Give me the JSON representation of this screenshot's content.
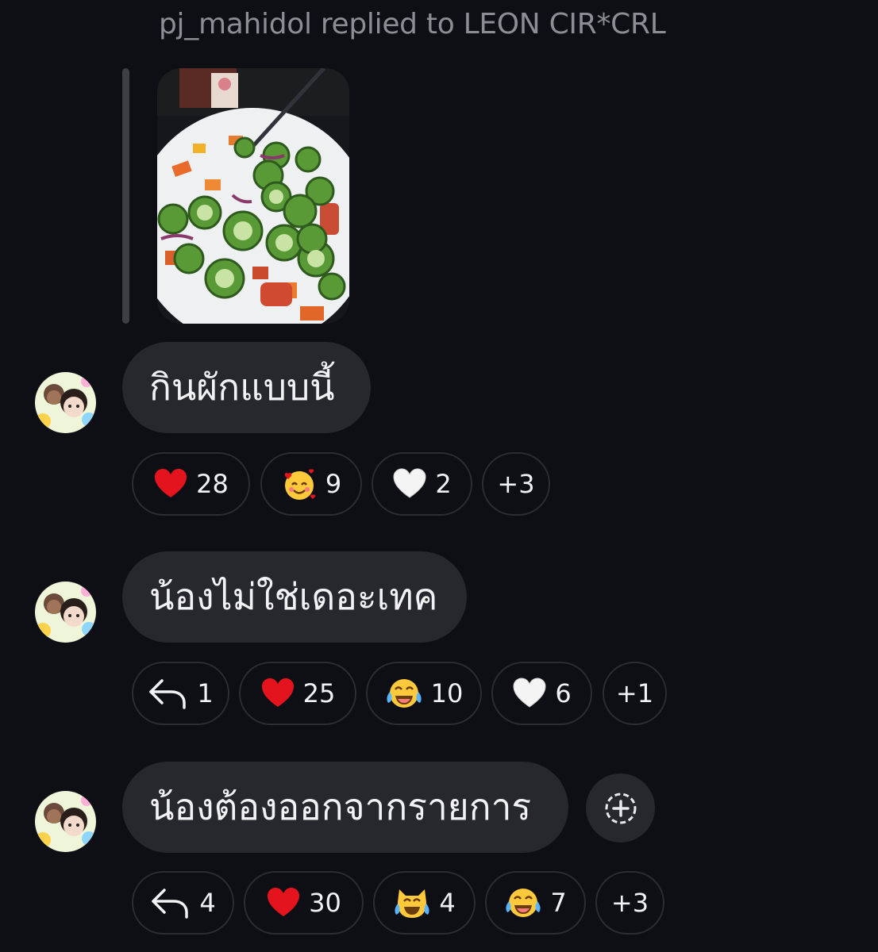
{
  "header": {
    "text": "pj_mahidol replied to LEON CIR*CRL"
  },
  "messages": [
    {
      "text": "กินผักแบบนี้",
      "reactions": [
        {
          "icon": "red-heart",
          "count": "28"
        },
        {
          "icon": "smiling-face-with-hearts",
          "count": "9"
        },
        {
          "icon": "white-heart",
          "count": "2"
        },
        {
          "label": "+3"
        }
      ]
    },
    {
      "text": "น้องไม่ใช่เดอะเทค",
      "reactions": [
        {
          "icon": "reply-arrow",
          "count": "1"
        },
        {
          "icon": "red-heart",
          "count": "25"
        },
        {
          "icon": "face-with-tears-of-joy",
          "count": "10"
        },
        {
          "icon": "white-heart",
          "count": "6"
        },
        {
          "label": "+1"
        }
      ]
    },
    {
      "text": "น้องต้องออกจากรายการ",
      "reactions": [
        {
          "icon": "reply-arrow",
          "count": "4"
        },
        {
          "icon": "red-heart",
          "count": "30"
        },
        {
          "icon": "cat-with-tears-of-joy",
          "count": "4"
        },
        {
          "icon": "face-with-tears-of-joy",
          "count": "7"
        },
        {
          "label": "+3"
        }
      ]
    }
  ],
  "add_reaction": {
    "icon": "add-reaction-icon"
  },
  "colors": {
    "background": "#0d0f14",
    "bubble": "#26282d",
    "pill_border": "#2b2d33",
    "muted_text": "#8c8e95"
  }
}
